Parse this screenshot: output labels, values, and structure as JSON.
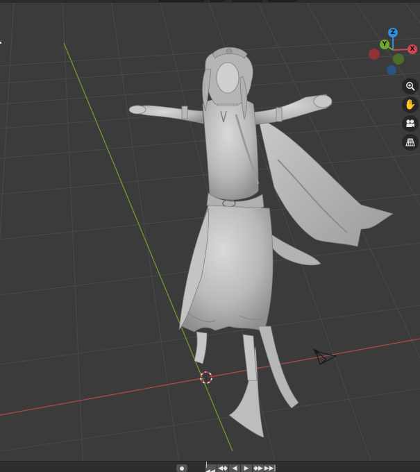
{
  "viewport": {
    "background": "#3b3b3b",
    "grid_color": "#4a4a4a",
    "x_axis_color": "#b4474b",
    "y_axis_color": "#6f9a34"
  },
  "nav_gizmo": {
    "axes": [
      {
        "name": "z-axis",
        "label": "Z",
        "color": "#2f8fd8"
      },
      {
        "name": "y-axis",
        "label": "Y",
        "color": "#6fa82f"
      },
      {
        "name": "x-axis",
        "label": "X",
        "color": "#d24552"
      },
      {
        "name": "neg-x-axis",
        "label": "",
        "color": "#8e3338"
      },
      {
        "name": "neg-y-axis",
        "label": "",
        "color": "#4d6c2a"
      },
      {
        "name": "neg-z-axis",
        "label": "",
        "color": "#2b5382"
      }
    ]
  },
  "toolbar": {
    "zoom_icon": "zoom-in-icon",
    "pan_icon": "hand-icon",
    "camera_icon": "camera-icon",
    "perspective_icon": "grid-perspective-icon"
  },
  "timeline": {
    "buttons": [
      {
        "name": "jump-start-button",
        "glyph": "|◀◀"
      },
      {
        "name": "jump-keyframe-back-button",
        "glyph": "◀◆"
      },
      {
        "name": "play-reverse-button",
        "glyph": "◀"
      },
      {
        "name": "play-button",
        "glyph": "▶"
      },
      {
        "name": "jump-keyframe-forward-button",
        "glyph": "◆▶"
      },
      {
        "name": "jump-end-button",
        "glyph": "▶▶|"
      }
    ]
  }
}
